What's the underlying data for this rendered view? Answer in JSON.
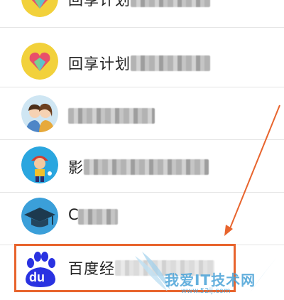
{
  "rows": [
    {
      "name": "回享计划",
      "avatar": "heart-gem-avatar"
    },
    {
      "name": "回享计划",
      "avatar": "heart-gem-avatar"
    },
    {
      "name": "",
      "avatar": "couple-avatar"
    },
    {
      "name": "影",
      "avatar": "cartoon-boy-avatar"
    },
    {
      "name": "C",
      "avatar": "graduation-cap-avatar"
    },
    {
      "name": "百度经",
      "avatar": "baidu-paw-logo"
    }
  ],
  "baidu_logo_text": "du",
  "watermark": {
    "text": "我爱IT技术网",
    "url": "www.52ij.com"
  },
  "colors": {
    "highlight": "#e8642d",
    "baidu_blue": "#2932e1",
    "watermark": "#4aa3d8"
  }
}
